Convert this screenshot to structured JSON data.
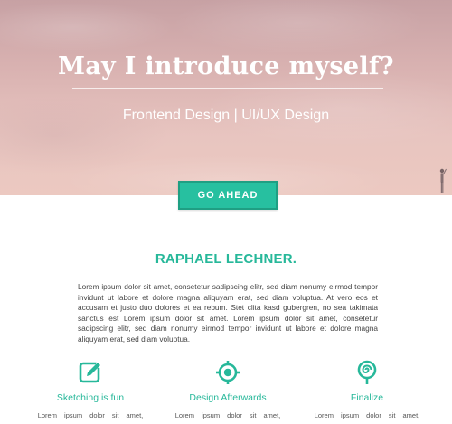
{
  "hero": {
    "title": "May I introduce myself?",
    "subtitle": "Frontend Design | UI/UX Design",
    "cta_label": "GO AHEAD"
  },
  "about": {
    "name": "RAPHAEL LECHNER.",
    "bio": "Lorem ipsum dolor sit amet, consetetur sadipscing elitr, sed diam nonumy eirmod tempor invidunt ut labore et dolore magna aliquyam erat, sed diam voluptua. At vero eos et accusam et justo duo dolores et ea rebum. Stet clita kasd gubergren, no sea takimata sanctus est Lorem ipsum dolor sit amet. Lorem ipsum dolor sit amet, consetetur sadipscing elitr, sed diam nonumy eirmod tempor invidunt ut labore et dolore magna aliquyam erat, sed diam voluptua."
  },
  "features": [
    {
      "icon": "edit-icon",
      "title": "Sketching is fun",
      "text": "Lorem ipsum dolor sit amet,"
    },
    {
      "icon": "target-icon",
      "title": "Design Afterwards",
      "text": "Lorem ipsum dolor sit amet,"
    },
    {
      "icon": "lollipop-icon",
      "title": "Finalize",
      "text": "Lorem ipsum dolor sit amet,"
    }
  ],
  "colors": {
    "accent": "#27b89a",
    "button": "#27c0a0",
    "hero_tint": "#d9b2b1"
  }
}
